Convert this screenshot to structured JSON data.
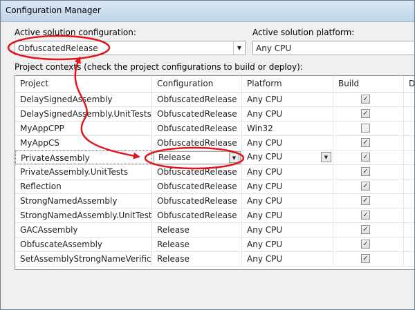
{
  "window": {
    "title": "Configuration Manager"
  },
  "solution_config": {
    "label": "Active solution configuration:",
    "value": "ObfuscatedRelease"
  },
  "solution_platform": {
    "label": "Active solution platform:",
    "value": "Any CPU"
  },
  "project_contexts_label": "Project contexts (check the project configurations to build or deploy):",
  "grid": {
    "headers": [
      "Project",
      "Configuration",
      "Platform",
      "Build",
      "Deploy"
    ],
    "rows": [
      {
        "project": "DelaySignedAssembly",
        "configuration": "ObfuscatedRelease",
        "platform": "Any CPU",
        "build": true
      },
      {
        "project": "DelaySignedAssembly.UnitTests",
        "configuration": "ObfuscatedRelease",
        "platform": "Any CPU",
        "build": true
      },
      {
        "project": "MyAppCPP",
        "configuration": "ObfuscatedRelease",
        "platform": "Win32",
        "build": false
      },
      {
        "project": "MyAppCS",
        "configuration": "ObfuscatedRelease",
        "platform": "Any CPU",
        "build": true
      },
      {
        "project": "PrivateAssembly",
        "configuration": "Release",
        "platform": "Any CPU",
        "build": true
      },
      {
        "project": "PrivateAssembly.UnitTests",
        "configuration": "ObfuscatedRelease",
        "platform": "Any CPU",
        "build": true
      },
      {
        "project": "Reflection",
        "configuration": "ObfuscatedRelease",
        "platform": "Any CPU",
        "build": true
      },
      {
        "project": "StrongNamedAssembly",
        "configuration": "ObfuscatedRelease",
        "platform": "Any CPU",
        "build": true
      },
      {
        "project": "StrongNamedAssembly.UnitTests",
        "configuration": "ObfuscatedRelease",
        "platform": "Any CPU",
        "build": true
      },
      {
        "project": "GACAssembly",
        "configuration": "Release",
        "platform": "Any CPU",
        "build": true
      },
      {
        "project": "ObfuscateAssembly",
        "configuration": "Release",
        "platform": "Any CPU",
        "build": true
      },
      {
        "project": "SetAssemblyStrongNameVerificat...",
        "configuration": "Release",
        "platform": "Any CPU",
        "build": true
      }
    ]
  },
  "colors": {
    "annotation": "#e0161d",
    "titlebar": "#cfdff0"
  },
  "icons": {
    "dropdown": "chevron-down-icon",
    "checkbox": "checkmark-icon"
  }
}
